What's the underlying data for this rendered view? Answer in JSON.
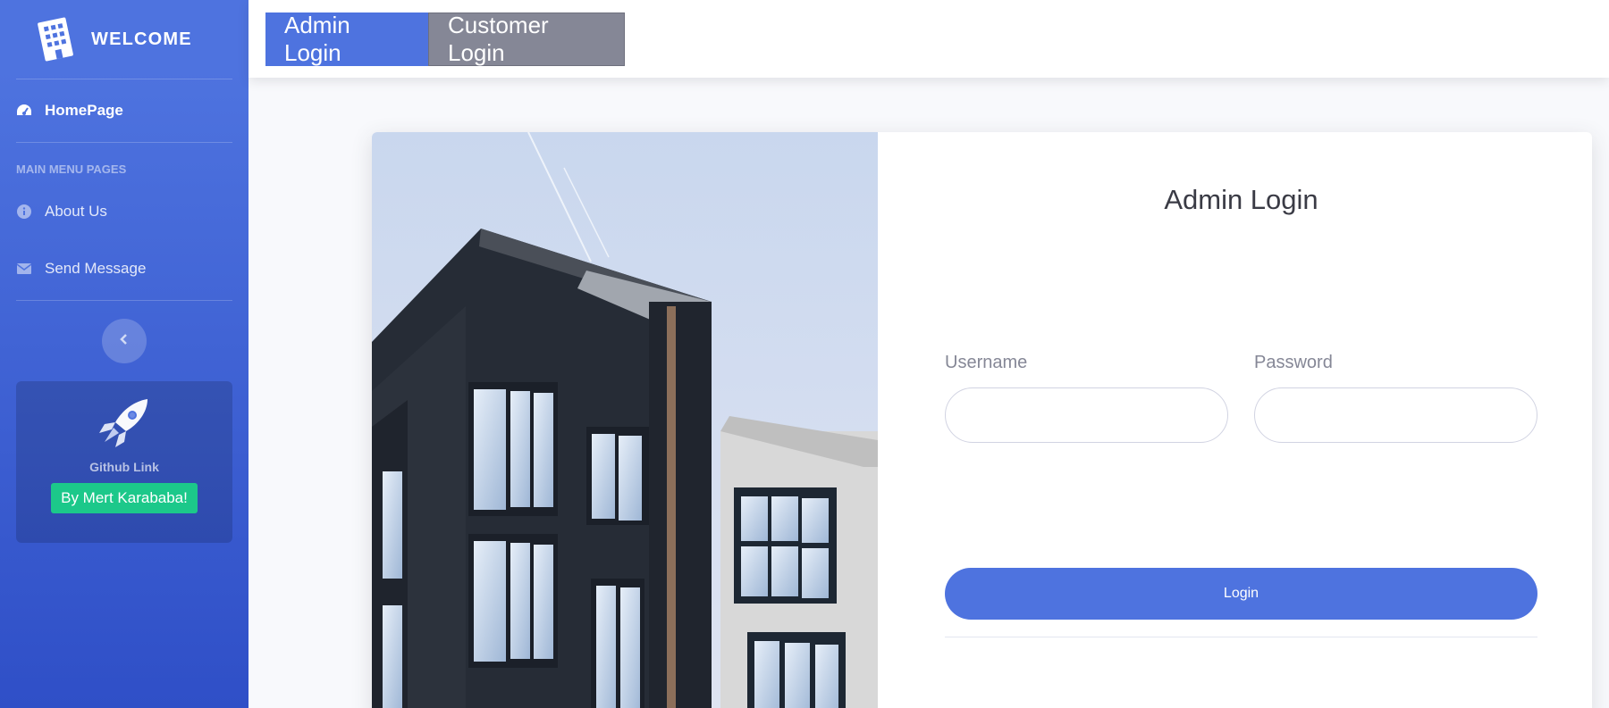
{
  "sidebar": {
    "brand": "WELCOME",
    "home": "HomePage",
    "heading": "MAIN MENU PAGES",
    "about": "About Us",
    "send": "Send Message",
    "github_text": "Github Link",
    "github_button": "By Mert Karababa!"
  },
  "tabs": {
    "admin": "Admin Login",
    "customer": "Customer Login"
  },
  "form": {
    "title": "Admin Login",
    "username_label": "Username",
    "password_label": "Password",
    "username_value": "",
    "password_value": "",
    "login_button": "Login"
  },
  "icons": {
    "brand": "building-icon",
    "home": "tachometer-icon",
    "about": "info-icon",
    "send": "envelope-icon",
    "toggle": "chevron-left-icon",
    "rocket": "rocket-icon"
  },
  "colors": {
    "primary": "#4e73df",
    "secondary": "#858796",
    "success": "#1cc88a"
  }
}
